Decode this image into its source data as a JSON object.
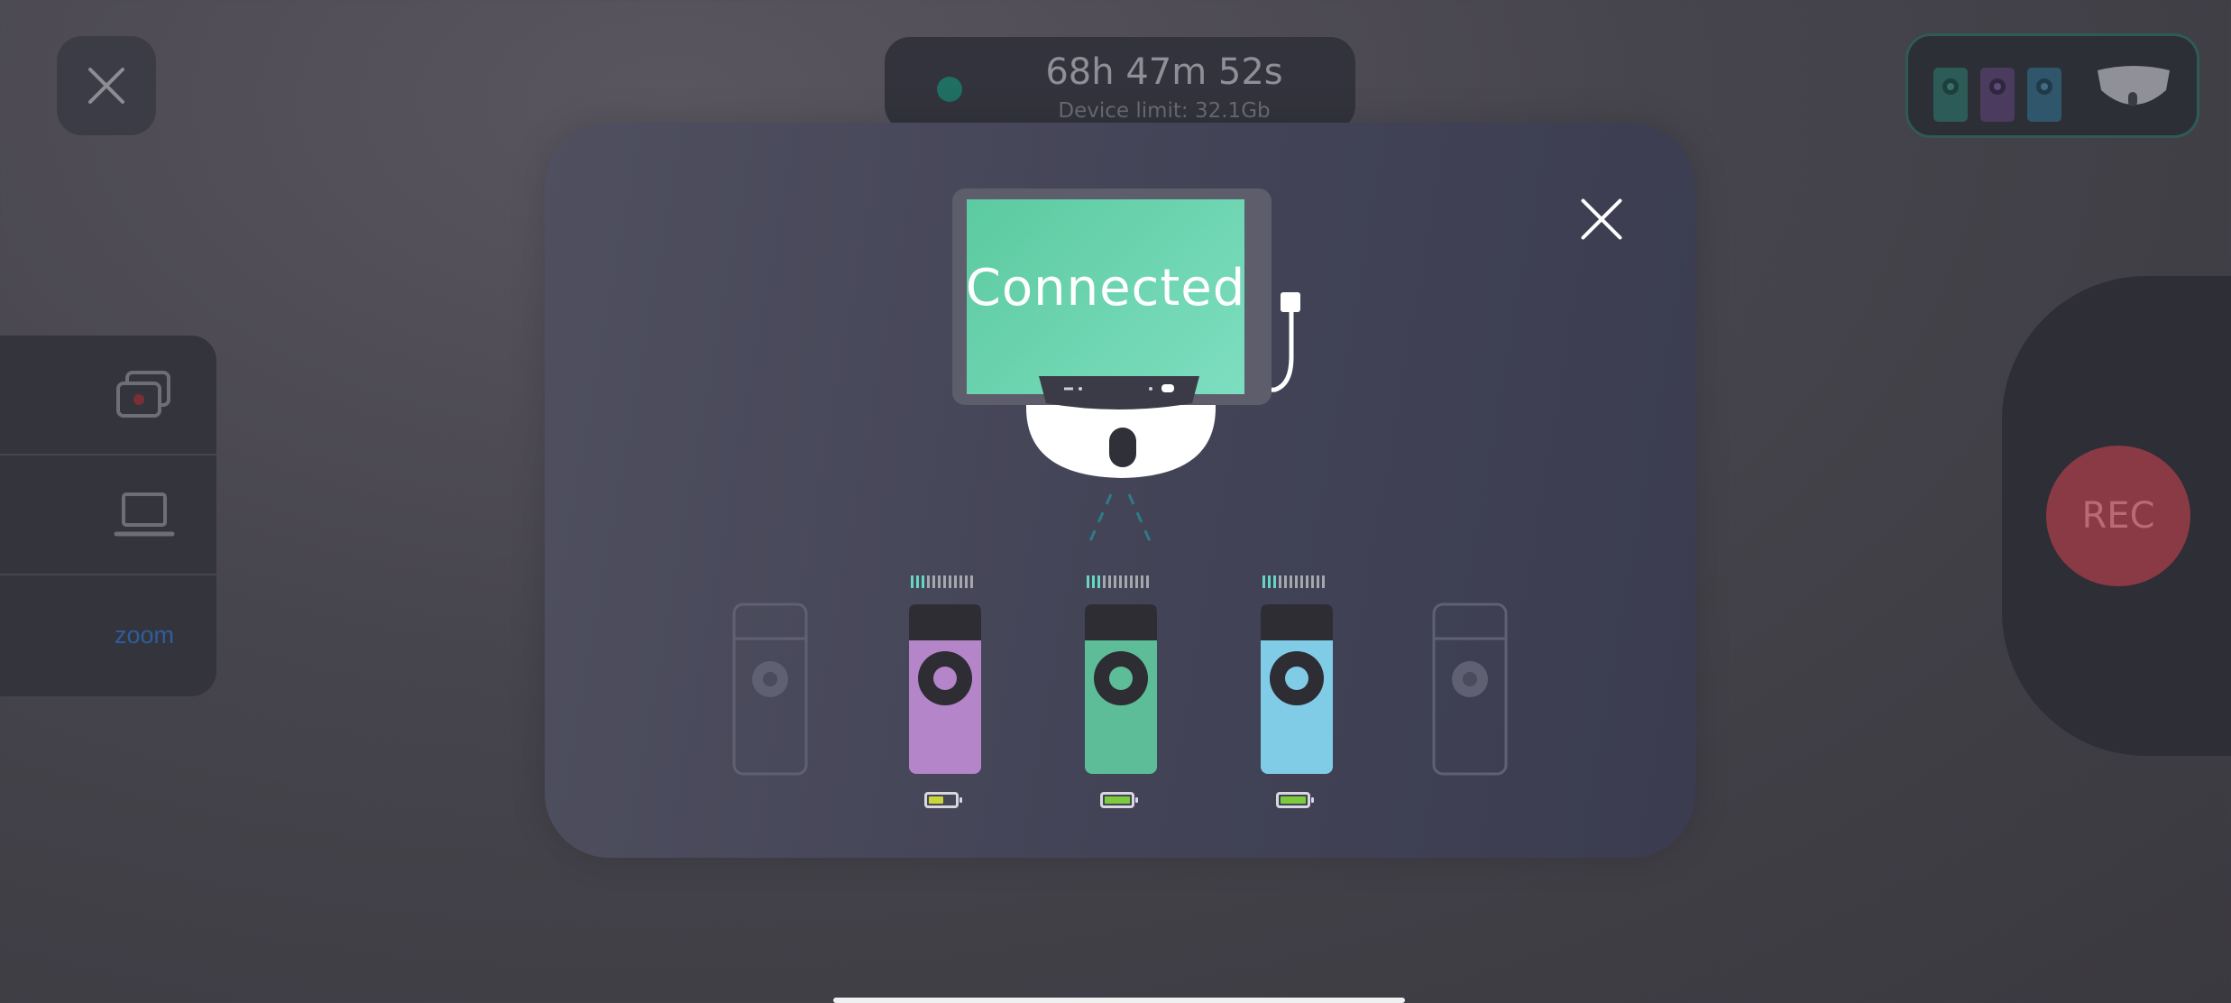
{
  "header": {
    "timer": "68h 47m 52s",
    "device_limit": "Device limit: 32.1Gb"
  },
  "side_panel": {
    "items": [
      {
        "name": "multi-camera-icon"
      },
      {
        "name": "laptop-icon"
      },
      {
        "label": "zoom"
      }
    ]
  },
  "record": {
    "label": "REC",
    "color": "#8a3a45"
  },
  "modal": {
    "status": "Connected",
    "transmitters": [
      {
        "color": "#b485c8",
        "battery_level": 0.5,
        "battery_color": "#c8d63a",
        "signal_bars": 3
      },
      {
        "color": "#5cbd98",
        "battery_level": 1.0,
        "battery_color": "#7ccb3c",
        "signal_bars": 3
      },
      {
        "color": "#80cbe6",
        "battery_level": 1.0,
        "battery_color": "#7ccb3c",
        "signal_bars": 3
      }
    ],
    "empty_slots": 2
  },
  "colors": {
    "accent": "#66d6c2",
    "screen": "#6ad6b0"
  }
}
